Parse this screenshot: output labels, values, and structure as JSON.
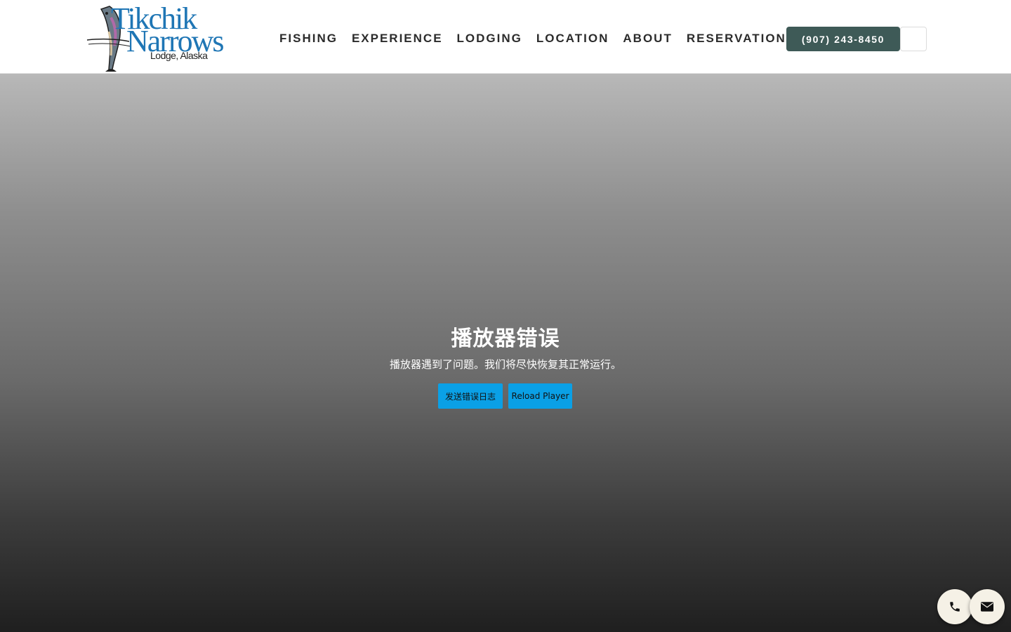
{
  "header": {
    "logo": {
      "line1": "Tikchik",
      "line2": "Narrows",
      "line3": "Lodge, Alaska"
    },
    "nav": [
      {
        "label": "FISHING"
      },
      {
        "label": "EXPERIENCE"
      },
      {
        "label": "LODGING"
      },
      {
        "label": "LOCATION"
      },
      {
        "label": "ABOUT"
      },
      {
        "label": "RESERVATIONS"
      }
    ],
    "phone_button": "(907) 243-8450"
  },
  "player": {
    "error_title": "播放器错误",
    "error_message": "播放器遇到了问题。我们将尽快恢复其正常运行。",
    "send_log_button": "发送错误日志",
    "reload_button": "Reload Player"
  },
  "floating_actions": {
    "call_icon": "phone-icon",
    "mail_icon": "envelope-icon"
  },
  "colors": {
    "brand_blue": "#1f76b5",
    "phone_button_bg": "#3e5a57",
    "error_button_bg": "#0aa0e6",
    "fab_bg": "#f5f1e6"
  }
}
